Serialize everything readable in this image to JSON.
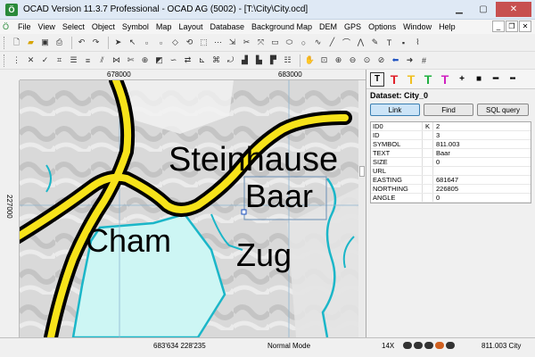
{
  "window": {
    "title": "OCAD Version 11.3.7  Professional - OCAD AG (5002) - [T:\\City\\City.ocd]",
    "icon": "ocad-app-icon"
  },
  "menu": [
    "File",
    "View",
    "Select",
    "Object",
    "Symbol",
    "Map",
    "Layout",
    "Database",
    "Background Map",
    "DEM",
    "GPS",
    "Options",
    "Window",
    "Help"
  ],
  "rulers": {
    "top": [
      "678000",
      "683000"
    ],
    "left": "227000"
  },
  "map": {
    "labels": [
      "Steinhause",
      "Baar",
      "Cham",
      "Zug"
    ],
    "colors": {
      "road_fill": "#f7e31a",
      "road_outline": "#000000",
      "water": "#cdf6f4",
      "water_edge": "#1bb6c8",
      "grid": "#8cb4d0"
    }
  },
  "panel": {
    "dataset_title": "Dataset: City_0",
    "buttons": [
      "Link",
      "Find",
      "SQL query"
    ],
    "rows": [
      {
        "key": "ID0",
        "flag": "K",
        "value": "2"
      },
      {
        "key": "ID",
        "flag": "",
        "value": "3"
      },
      {
        "key": "SYMBOL",
        "flag": "",
        "value": "811.003"
      },
      {
        "key": "TEXT",
        "flag": "",
        "value": "Baar"
      },
      {
        "key": "SIZE",
        "flag": "",
        "value": "0"
      },
      {
        "key": "URL",
        "flag": "",
        "value": ""
      },
      {
        "key": "EASTING",
        "flag": "",
        "value": "681647"
      },
      {
        "key": "NORTHING",
        "flag": "",
        "value": "226805"
      },
      {
        "key": "ANGLE",
        "flag": "",
        "value": "0"
      }
    ]
  },
  "status": {
    "coordinates": "683'634   228'235",
    "mode": "Normal Mode",
    "zoom": "14X",
    "symbol": "811.003 City"
  }
}
